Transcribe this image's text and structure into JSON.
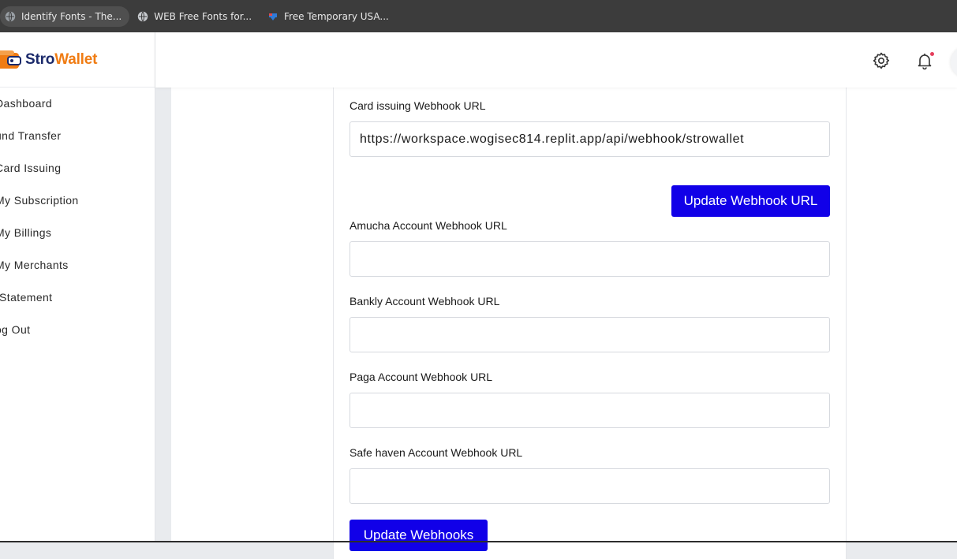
{
  "bookmarks": [
    {
      "label": "Identify Fonts - The...",
      "icon": "globe-icon",
      "active": true
    },
    {
      "label": "WEB Free Fonts for...",
      "icon": "globe-icon",
      "active": false
    },
    {
      "label": "Free Temporary USA...",
      "icon": "flag-icon",
      "active": false
    }
  ],
  "brand": {
    "part1": "Stro",
    "part2": "Wallet",
    "color_primary": "#1b2a6b",
    "color_accent": "#f07c13"
  },
  "sidebar": {
    "items": [
      {
        "label": "Dashboard"
      },
      {
        "label": "und Transfer"
      },
      {
        "label": "Card Issuing"
      },
      {
        "label": "My Subscription"
      },
      {
        "label": "My Billings"
      },
      {
        "label": "My Merchants"
      },
      {
        "label": "-Statement"
      },
      {
        "label": "og Out"
      }
    ]
  },
  "header": {
    "settings_icon": "gear-icon",
    "notifications_icon": "bell-icon",
    "notification_dot_color": "#e53e5c"
  },
  "form": {
    "card_issuing": {
      "label": "Card issuing Webhook URL",
      "value": "https://workspace.wogisec814.replit.app/api/webhook/strowallet"
    },
    "update_webhook_button": "Update Webhook URL",
    "amucha": {
      "label": "Amucha Account Webhook URL",
      "value": ""
    },
    "bankly": {
      "label": "Bankly Account Webhook URL",
      "value": ""
    },
    "paga": {
      "label": "Paga Account Webhook URL",
      "value": ""
    },
    "safe_haven": {
      "label": "Safe haven Account Webhook URL",
      "value": ""
    },
    "update_webhooks_button": "Update Webhooks",
    "button_color": "#1100e8"
  }
}
